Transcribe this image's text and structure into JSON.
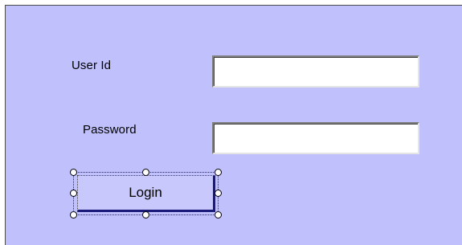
{
  "form": {
    "user_id_label": "User Id",
    "password_label": "Password",
    "user_id_value": "",
    "password_value": "",
    "login_label": "Login"
  },
  "colors": {
    "form_background": "#c0c0fc",
    "button_background": "#c8c8fc",
    "selection_accent": "#1a1a7a"
  }
}
